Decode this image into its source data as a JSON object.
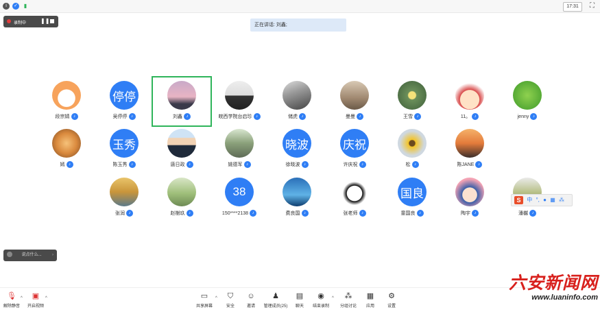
{
  "topbar": {
    "time": "17:31",
    "icons": [
      "info-icon",
      "shield-icon",
      "signal-icon"
    ]
  },
  "recording": {
    "label": "录制中"
  },
  "speaking": {
    "label": "正在讲话: 刘鑫;"
  },
  "participants": [
    {
      "name": "段宗婧",
      "avatar_type": "image",
      "avatar_icon": "cartoon-avatar"
    },
    {
      "name": "吴停停",
      "avatar_type": "text",
      "avatar_text": "停停"
    },
    {
      "name": "刘鑫",
      "avatar_type": "image",
      "avatar_icon": "sky-photo-avatar",
      "active": true
    },
    {
      "name": "皖西学院台启珍",
      "avatar_type": "image",
      "avatar_icon": "person-photo-avatar"
    },
    {
      "name": "储虎",
      "avatar_type": "image",
      "avatar_icon": "selfie-avatar"
    },
    {
      "name": "曼曼",
      "avatar_type": "image",
      "avatar_icon": "landscape-avatar"
    },
    {
      "name": "王雪",
      "avatar_type": "image",
      "avatar_icon": "flower-avatar"
    },
    {
      "name": "11。",
      "avatar_type": "image",
      "avatar_icon": "cartoon-girl-avatar"
    },
    {
      "name": "jenny",
      "avatar_type": "image",
      "avatar_icon": "green-drops-avatar"
    },
    {
      "name": "嫣",
      "avatar_type": "image",
      "avatar_icon": "bouquet-avatar"
    },
    {
      "name": "陈玉秀",
      "avatar_type": "text",
      "avatar_text": "玉秀"
    },
    {
      "name": "唐日政",
      "avatar_type": "image",
      "avatar_icon": "portrait-avatar"
    },
    {
      "name": "姚德军",
      "avatar_type": "image",
      "avatar_icon": "street-avatar"
    },
    {
      "name": "徐晓波",
      "avatar_type": "text",
      "avatar_text": "晓波"
    },
    {
      "name": "许庆祝",
      "avatar_type": "text",
      "avatar_text": "庆祝"
    },
    {
      "name": "松",
      "avatar_type": "image",
      "avatar_icon": "sunflower-avatar"
    },
    {
      "name": "陈JANE",
      "avatar_type": "image",
      "avatar_icon": "sunset-avatar"
    },
    {
      "name": "张润",
      "avatar_type": "image",
      "avatar_icon": "autumn-tree-avatar"
    },
    {
      "name": "赵樹玖",
      "avatar_type": "image",
      "avatar_icon": "willow-avatar"
    },
    {
      "name": "150****2138",
      "avatar_type": "text",
      "avatar_text": "38"
    },
    {
      "name": "费良国",
      "avatar_type": "image",
      "avatar_icon": "sky-avatar"
    },
    {
      "name": "张老师",
      "avatar_type": "image",
      "avatar_icon": "panda-avatar"
    },
    {
      "name": "童国良",
      "avatar_type": "text",
      "avatar_text": "国良"
    },
    {
      "name": "陶宇",
      "avatar_type": "image",
      "avatar_icon": "anime-avatar"
    },
    {
      "name": "潘樾",
      "avatar_type": "image",
      "avatar_icon": "plant-avatar"
    }
  ],
  "chat_input": {
    "placeholder": "说点什么..."
  },
  "toolbar": {
    "mute": "解除静音",
    "video": "开启视频",
    "share": "共享屏幕",
    "security": "安全",
    "invite": "邀请",
    "participants": "管理成员(25)",
    "chat": "聊天",
    "record": "结束录制",
    "breakout": "分组讨论",
    "apps": "应用",
    "settings": "设置"
  },
  "ime": {
    "label": "中"
  },
  "watermark": {
    "title": "六安新闻网",
    "url": "www.luaninfo.com"
  },
  "colors": {
    "accent": "#2f7ef5",
    "active_border": "#2eb45a",
    "watermark_red": "#d8201c"
  }
}
